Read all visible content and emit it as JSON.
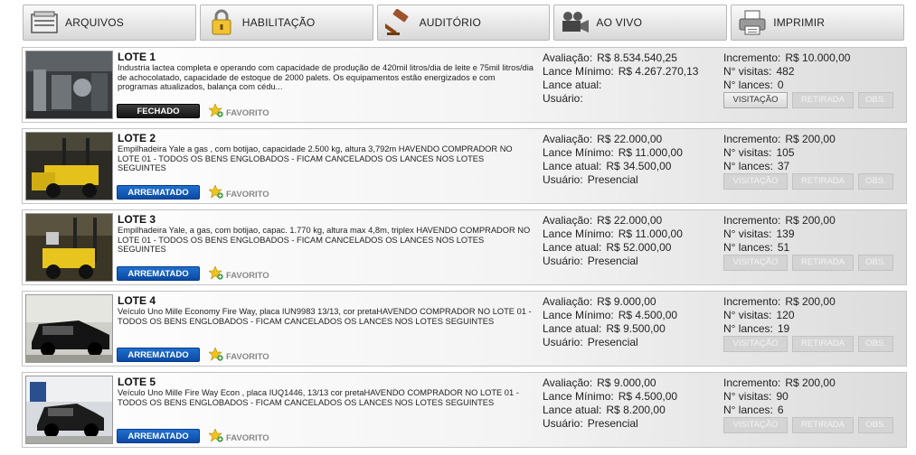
{
  "nav": {
    "arquivos": {
      "label": "ARQUIVOS",
      "icon": "folder-icon"
    },
    "habilitacao": {
      "label": "HABILITAÇÃO",
      "icon": "lock-icon"
    },
    "auditorio": {
      "label": "AUDITÓRIO",
      "icon": "gavel-icon"
    },
    "aovivo": {
      "label": "AO VIVO",
      "icon": "video-camera-icon"
    },
    "imprimir": {
      "label": "IMPRIMIR",
      "icon": "printer-icon"
    }
  },
  "colors": {
    "fechado": "#1e1e1e",
    "arrematado": "#0f57b8",
    "favorite_star": "#f2c31b"
  },
  "lots": [
    {
      "title": "LOTE 1",
      "description": "Industria lactea completa e operando com capacidade de produção de 420mil litros/dia de leite e 75mil litros/dia de achocolatado, capacidade de estoque de 2000 palets. Os equipamentos estão energizados e com programas atualizados, balança com cédu...",
      "status": "FECHADO",
      "favorite": "FAVORITO",
      "avaliacao_label": "Avaliação:",
      "avaliacao": "R$ 8.534.540,25",
      "lance_minimo_label": "Lance Mínimo:",
      "lance_minimo": "R$ 4.267.270,13",
      "lance_atual_label": "Lance atual:",
      "lance_atual": "",
      "usuario_label": "Usuário:",
      "usuario": "",
      "incremento_label": "Incremento:",
      "incremento": "R$ 10.000,00",
      "visitas_label": "N° visitas:",
      "visitas": "482",
      "lances_label": "N° lances:",
      "lances": "0",
      "btn_visitacao": "VISITAÇÃO",
      "btn_retirada": "RETIRADA",
      "btn_obs": "OBS."
    },
    {
      "title": "LOTE 2",
      "description": "Empilhadeira Yale a gas , com botijao, capacidade 2.500 kg, altura 3,792m HAVENDO COMPRADOR NO LOTE 01 - TODOS OS BENS ENGLOBADOS - FICAM CANCELADOS OS LANCES NOS LOTES SEGUINTES",
      "status": "ARREMATADO",
      "favorite": "FAVORITO",
      "avaliacao_label": "Avaliação:",
      "avaliacao": "R$ 22.000,00",
      "lance_minimo_label": "Lance Mínimo:",
      "lance_minimo": "R$ 11.000,00",
      "lance_atual_label": "Lance atual:",
      "lance_atual": "R$ 34.500,00",
      "usuario_label": "Usuário:",
      "usuario": "Presencial",
      "incremento_label": "Incremento:",
      "incremento": "R$ 200,00",
      "visitas_label": "N° visitas:",
      "visitas": "105",
      "lances_label": "N° lances:",
      "lances": "37",
      "btn_visitacao": "VISITAÇÃO",
      "btn_retirada": "RETIRADA",
      "btn_obs": "OBS."
    },
    {
      "title": "LOTE 3",
      "description": "Empilhadeira Yale, a gas, com botijao, capac. 1.770 kg, altura max 4,8m, triplex HAVENDO COMPRADOR NO LOTE 01 - TODOS OS BENS ENGLOBADOS - FICAM CANCELADOS OS LANCES NOS LOTES SEGUINTES",
      "status": "ARREMATADO",
      "favorite": "FAVORITO",
      "avaliacao_label": "Avaliação:",
      "avaliacao": "R$ 22.000,00",
      "lance_minimo_label": "Lance Mínimo:",
      "lance_minimo": "R$ 11.000,00",
      "lance_atual_label": "Lance atual:",
      "lance_atual": "R$ 52.000,00",
      "usuario_label": "Usuário:",
      "usuario": "Presencial",
      "incremento_label": "Incremento:",
      "incremento": "R$ 200,00",
      "visitas_label": "N° visitas:",
      "visitas": "139",
      "lances_label": "N° lances:",
      "lances": "51",
      "btn_visitacao": "VISITAÇÃO",
      "btn_retirada": "RETIRADA",
      "btn_obs": "OBS."
    },
    {
      "title": "LOTE 4",
      "description": "Veículo Uno Mille Economy Fire Way, placa IUN9983 13/13, cor pretaHAVENDO COMPRADOR NO LOTE 01 - TODOS OS BENS ENGLOBADOS - FICAM CANCELADOS OS LANCES NOS LOTES SEGUINTES",
      "status": "ARREMATADO",
      "favorite": "FAVORITO",
      "avaliacao_label": "Avaliação:",
      "avaliacao": "R$ 9.000,00",
      "lance_minimo_label": "Lance Mínimo:",
      "lance_minimo": "R$ 4.500,00",
      "lance_atual_label": "Lance atual:",
      "lance_atual": "R$ 9.500,00",
      "usuario_label": "Usuário:",
      "usuario": "Presencial",
      "incremento_label": "Incremento:",
      "incremento": "R$ 200,00",
      "visitas_label": "N° visitas:",
      "visitas": "120",
      "lances_label": "N° lances:",
      "lances": "19",
      "btn_visitacao": "VISITAÇÃO",
      "btn_retirada": "RETIRADA",
      "btn_obs": "OBS."
    },
    {
      "title": "LOTE 5",
      "description": "Veículo Uno Mille Fire Way Econ , placa IUQ1446, 13/13 cor pretaHAVENDO COMPRADOR NO LOTE 01 - TODOS OS BENS ENGLOBADOS - FICAM CANCELADOS OS LANCES NOS LOTES SEGUINTES",
      "status": "ARREMATADO",
      "favorite": "FAVORITO",
      "avaliacao_label": "Avaliação:",
      "avaliacao": "R$ 9.000,00",
      "lance_minimo_label": "Lance Mínimo:",
      "lance_minimo": "R$ 4.500,00",
      "lance_atual_label": "Lance atual:",
      "lance_atual": "R$ 8.200,00",
      "usuario_label": "Usuário:",
      "usuario": "Presencial",
      "incremento_label": "Incremento:",
      "incremento": "R$ 200,00",
      "visitas_label": "N° visitas:",
      "visitas": "90",
      "lances_label": "N° lances:",
      "lances": "6",
      "btn_visitacao": "VISITAÇÃO",
      "btn_retirada": "RETIRADA",
      "btn_obs": "OBS."
    }
  ]
}
